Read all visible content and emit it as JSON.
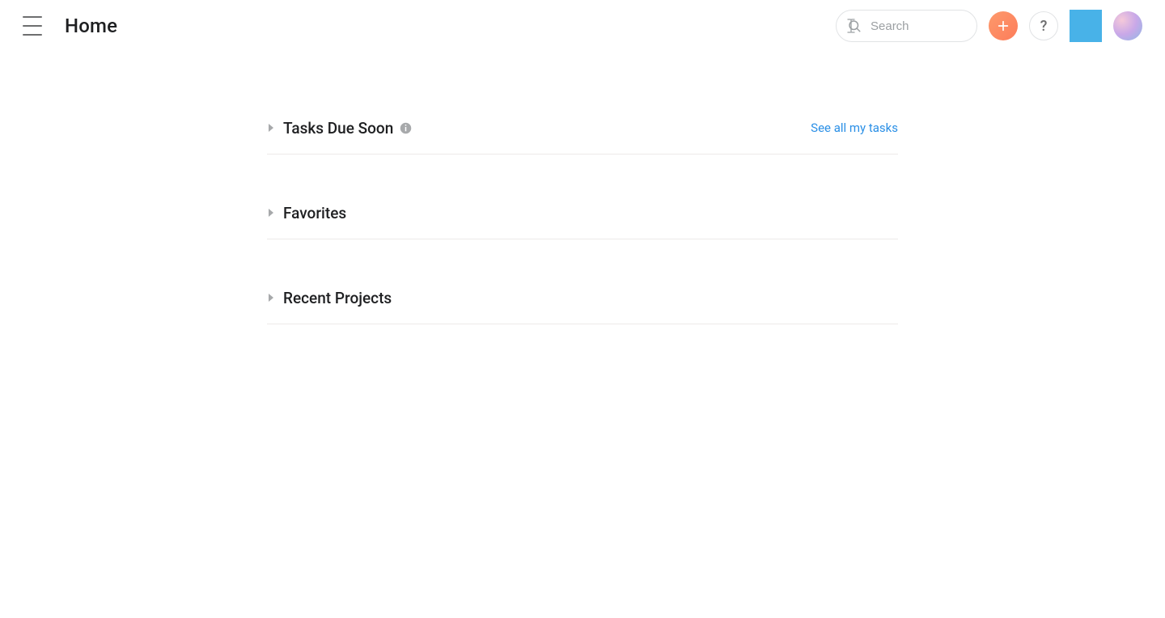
{
  "header": {
    "title": "Home",
    "search_placeholder": "Search",
    "help_label": "?"
  },
  "sections": {
    "tasks": {
      "title": "Tasks Due Soon",
      "link": "See all my tasks"
    },
    "favorites": {
      "title": "Favorites"
    },
    "recent": {
      "title": "Recent Projects"
    }
  }
}
